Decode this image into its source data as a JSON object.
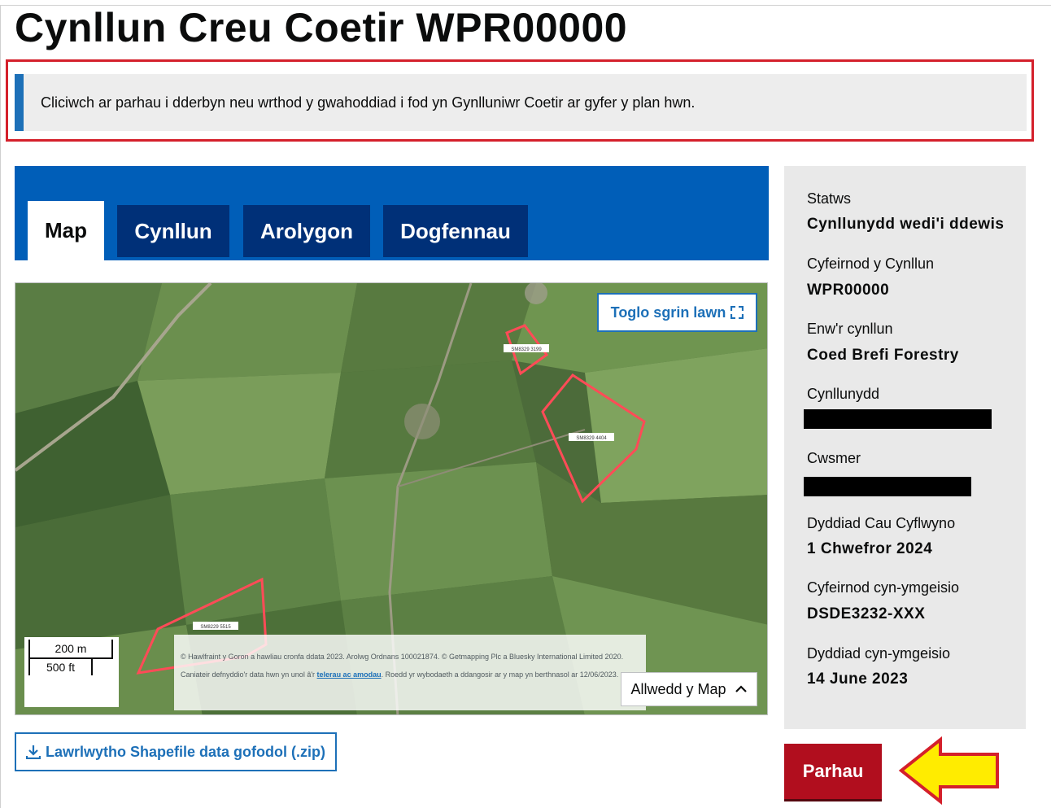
{
  "page": {
    "title": "Cynllun Creu Coetir WPR00000",
    "notice": "Cliciwch ar parhau i dderbyn neu wrthod y gwahoddiad i fod yn Gynlluniwr Coetir ar gyfer y plan hwn."
  },
  "tabs": [
    {
      "label": "Map",
      "active": true
    },
    {
      "label": "Cynllun",
      "active": false
    },
    {
      "label": "Arolygon",
      "active": false
    },
    {
      "label": "Dogfennau",
      "active": false
    }
  ],
  "map": {
    "toggle_label": "Toglo sgrin lawn",
    "scale_metric": "200 m",
    "scale_imperial": "500 ft",
    "parcel_labels": [
      "SM8329 3199",
      "SM8329 4404",
      "SM8229 5515"
    ],
    "attribution_part1": "© Hawlfraint y Goron a hawliau cronfa ddata 2023. Arolwg Ordnans 100021874. © Getmapping Plc a Bluesky International Limited 2020. Caniateir defnyddio'r data hwn yn unol â'r ",
    "attribution_link": "telerau ac amodau",
    "attribution_part2": ". Roedd yr wybodaeth a ddangosir ar y map yn berthnasol ar 12/06/2023.",
    "legend_label": "Allwedd y Map"
  },
  "download": {
    "label": "Lawrlwytho Shapefile data gofodol (.zip)"
  },
  "summary": {
    "status_label": "Statws",
    "status_value": "Cynllunydd wedi'i ddewis",
    "plan_ref_label": "Cyfeirnod y Cynllun",
    "plan_ref_value": "WPR00000",
    "plan_name_label": "Enw'r cynllun",
    "plan_name_value": "Coed Brefi Forestry",
    "planner_label": "Cynllunydd",
    "customer_label": "Cwsmer",
    "closing_date_label": "Dyddiad Cau Cyflwyno",
    "closing_date_value": "1 Chwefror 2024",
    "pre_app_ref_label": "Cyfeirnod cyn-ymgeisio",
    "pre_app_ref_value": "DSDE3232-XXX",
    "pre_app_date_label": "Dyddiad cyn-ymgeisio",
    "pre_app_date_value": "14 June 2023"
  },
  "continue_label": "Parhau",
  "colors": {
    "brand_blue": "#005eb8",
    "tab_dark": "#003078",
    "link_blue": "#1d70b8",
    "continue_red": "#b10e1e",
    "highlight_red": "#d4202b",
    "annotation_arrow": "#ffec00"
  }
}
